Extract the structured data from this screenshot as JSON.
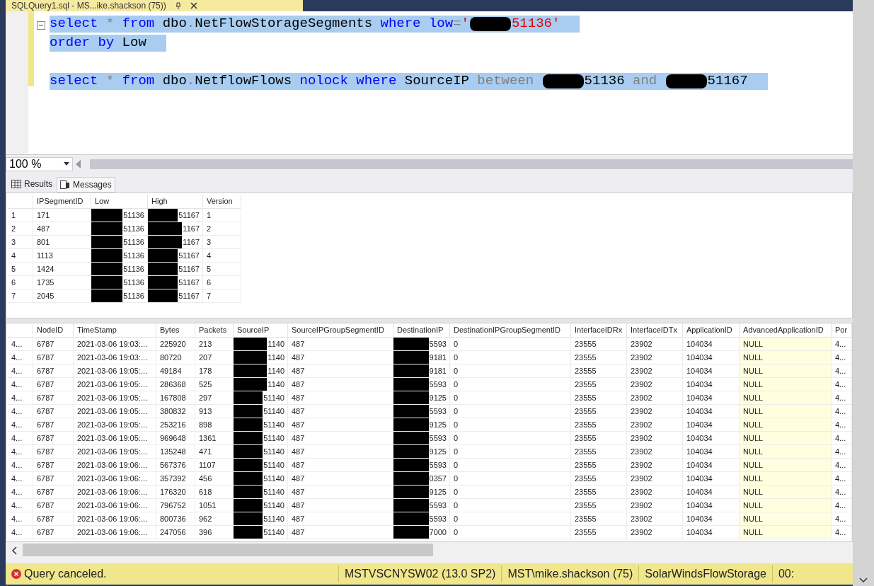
{
  "document_tab": {
    "title": "SQLQuery1.sql - MS...ike.shackson (75))"
  },
  "editor": {
    "lines": [
      {
        "kind": "code",
        "tokens": [
          {
            "kind": "keyword",
            "text": "select"
          },
          {
            "kind": "operator",
            "text": " * "
          },
          {
            "kind": "keyword",
            "text": "from"
          },
          {
            "kind": "plain",
            "text": " dbo"
          },
          {
            "kind": "operator",
            "text": "."
          },
          {
            "kind": "plain",
            "text": "NetFlowStorageSegments "
          },
          {
            "kind": "keyword",
            "text": "where low"
          },
          {
            "kind": "operator",
            "text": "="
          },
          {
            "kind": "string",
            "text": "'"
          },
          {
            "kind": "redaction"
          },
          {
            "kind": "string",
            "text": "51136'"
          }
        ]
      },
      {
        "kind": "code",
        "tokens": [
          {
            "kind": "keyword",
            "text": "order by"
          },
          {
            "kind": "plain",
            "text": " Low"
          }
        ]
      },
      {
        "kind": "blank"
      },
      {
        "kind": "code",
        "tokens": [
          {
            "kind": "keyword",
            "text": "select"
          },
          {
            "kind": "operator",
            "text": " * "
          },
          {
            "kind": "keyword",
            "text": "from"
          },
          {
            "kind": "plain",
            "text": " dbo"
          },
          {
            "kind": "operator",
            "text": "."
          },
          {
            "kind": "plain",
            "text": "NetflowFlows "
          },
          {
            "kind": "keyword",
            "text": "nolock where"
          },
          {
            "kind": "plain",
            "text": " SourceIP "
          },
          {
            "kind": "operator",
            "text": "between "
          },
          {
            "kind": "redaction"
          },
          {
            "kind": "plain",
            "text": "51136 "
          },
          {
            "kind": "operator",
            "text": "and "
          },
          {
            "kind": "redaction"
          },
          {
            "kind": "plain",
            "text": "51167"
          }
        ]
      }
    ]
  },
  "zoom": {
    "value": "100 %"
  },
  "result_tabs": [
    {
      "label": "Results",
      "selected": true
    },
    {
      "label": "Messages",
      "selected": false
    }
  ],
  "grid_1": {
    "columns": [
      {
        "kind": "row_header"
      },
      {
        "kind": "data",
        "label": "IPSegmentID"
      },
      {
        "kind": "data",
        "label": "Low",
        "redacted": true
      },
      {
        "kind": "data",
        "label": "High",
        "redacted": true
      },
      {
        "kind": "data",
        "label": "Version"
      }
    ],
    "rows": [
      [
        "1",
        "171",
        "51136",
        "51167",
        "1"
      ],
      [
        "2",
        "487",
        "51136",
        "1167",
        "2"
      ],
      [
        "3",
        "801",
        "51136",
        "1167",
        "3"
      ],
      [
        "4",
        "1113",
        "51136",
        "51167",
        "4"
      ],
      [
        "5",
        "1424",
        "51136",
        "51167",
        "5"
      ],
      [
        "6",
        "1735",
        "51136",
        "51167",
        "6"
      ],
      [
        "7",
        "2045",
        "51136",
        "51167",
        "7"
      ]
    ]
  },
  "grid_2": {
    "columns": [
      {
        "kind": "row_header"
      },
      {
        "kind": "data",
        "label": "NodeID"
      },
      {
        "kind": "data",
        "label": "TimeStamp"
      },
      {
        "kind": "data",
        "label": "Bytes"
      },
      {
        "kind": "data",
        "label": "Packets"
      },
      {
        "kind": "data",
        "label": "SourceIP",
        "redacted": true
      },
      {
        "kind": "data",
        "label": "SourceIPGroupSegmentID"
      },
      {
        "kind": "data",
        "label": "DestinationIP",
        "redacted": true
      },
      {
        "kind": "data",
        "label": "DestinationIPGroupSegmentID"
      },
      {
        "kind": "data",
        "label": "InterfaceIDRx"
      },
      {
        "kind": "data",
        "label": "InterfaceIDTx"
      },
      {
        "kind": "data",
        "label": "ApplicationID"
      },
      {
        "kind": "data",
        "label": "AdvancedApplicationID"
      },
      {
        "kind": "data",
        "label": "Por"
      }
    ],
    "rows": [
      [
        "4...",
        "6787",
        "2021-03-06 19:03:...",
        "225920",
        "213",
        "1140",
        "487",
        "5593",
        "0",
        "23555",
        "23902",
        "104034",
        "NULL",
        "4..."
      ],
      [
        "4...",
        "6787",
        "2021-03-06 19:03:...",
        "80720",
        "207",
        "1140",
        "487",
        "9181",
        "0",
        "23555",
        "23902",
        "104034",
        "NULL",
        "4..."
      ],
      [
        "4...",
        "6787",
        "2021-03-06 19:05:...",
        "49184",
        "178",
        "1140",
        "487",
        "9181",
        "0",
        "23555",
        "23902",
        "104034",
        "NULL",
        "4..."
      ],
      [
        "4...",
        "6787",
        "2021-03-06 19:05:...",
        "286368",
        "525",
        "1140",
        "487",
        "5593",
        "0",
        "23555",
        "23902",
        "104034",
        "NULL",
        "4..."
      ],
      [
        "4...",
        "6787",
        "2021-03-06 19:05:...",
        "167808",
        "297",
        "51140",
        "487",
        "9125",
        "0",
        "23555",
        "23902",
        "104034",
        "NULL",
        "4..."
      ],
      [
        "4...",
        "6787",
        "2021-03-06 19:05:...",
        "380832",
        "913",
        "51140",
        "487",
        "5593",
        "0",
        "23555",
        "23902",
        "104034",
        "NULL",
        "4..."
      ],
      [
        "4...",
        "6787",
        "2021-03-06 19:05:...",
        "253216",
        "898",
        "51140",
        "487",
        "9125",
        "0",
        "23555",
        "23902",
        "104034",
        "NULL",
        "4..."
      ],
      [
        "4...",
        "6787",
        "2021-03-06 19:05:...",
        "969648",
        "1361",
        "51140",
        "487",
        "5593",
        "0",
        "23555",
        "23902",
        "104034",
        "NULL",
        "4..."
      ],
      [
        "4...",
        "6787",
        "2021-03-06 19:05:...",
        "135248",
        "471",
        "51140",
        "487",
        "9125",
        "0",
        "23555",
        "23902",
        "104034",
        "NULL",
        "4..."
      ],
      [
        "4...",
        "6787",
        "2021-03-06 19:06:...",
        "567376",
        "1107",
        "51140",
        "487",
        "5593",
        "0",
        "23555",
        "23902",
        "104034",
        "NULL",
        "4..."
      ],
      [
        "4...",
        "6787",
        "2021-03-06 19:06:...",
        "357392",
        "456",
        "51140",
        "487",
        "0357",
        "0",
        "23555",
        "23902",
        "104034",
        "NULL",
        "4..."
      ],
      [
        "4...",
        "6787",
        "2021-03-06 19:06:...",
        "176320",
        "618",
        "51140",
        "487",
        "9125",
        "0",
        "23555",
        "23902",
        "104034",
        "NULL",
        "4..."
      ],
      [
        "4...",
        "6787",
        "2021-03-06 19:06:...",
        "796752",
        "1051",
        "51140",
        "487",
        "5593",
        "0",
        "23555",
        "23902",
        "104034",
        "NULL",
        "4..."
      ],
      [
        "4...",
        "6787",
        "2021-03-06 19:06:...",
        "800736",
        "962",
        "51140",
        "487",
        "5593",
        "0",
        "23555",
        "23902",
        "104034",
        "NULL",
        "4..."
      ],
      [
        "4...",
        "6787",
        "2021-03-06 19:06:...",
        "247056",
        "396",
        "51140",
        "487",
        "7000",
        "0",
        "23555",
        "23902",
        "104034",
        "NULL",
        "4..."
      ]
    ]
  },
  "status_bar": {
    "message": "Query canceled.",
    "kind": "error",
    "sections": [
      "MSTVSCNYSW02 (13.0 SP2)",
      "MST\\mike.shackson (75)",
      "SolarWindsFlowStorage",
      "00:"
    ]
  }
}
